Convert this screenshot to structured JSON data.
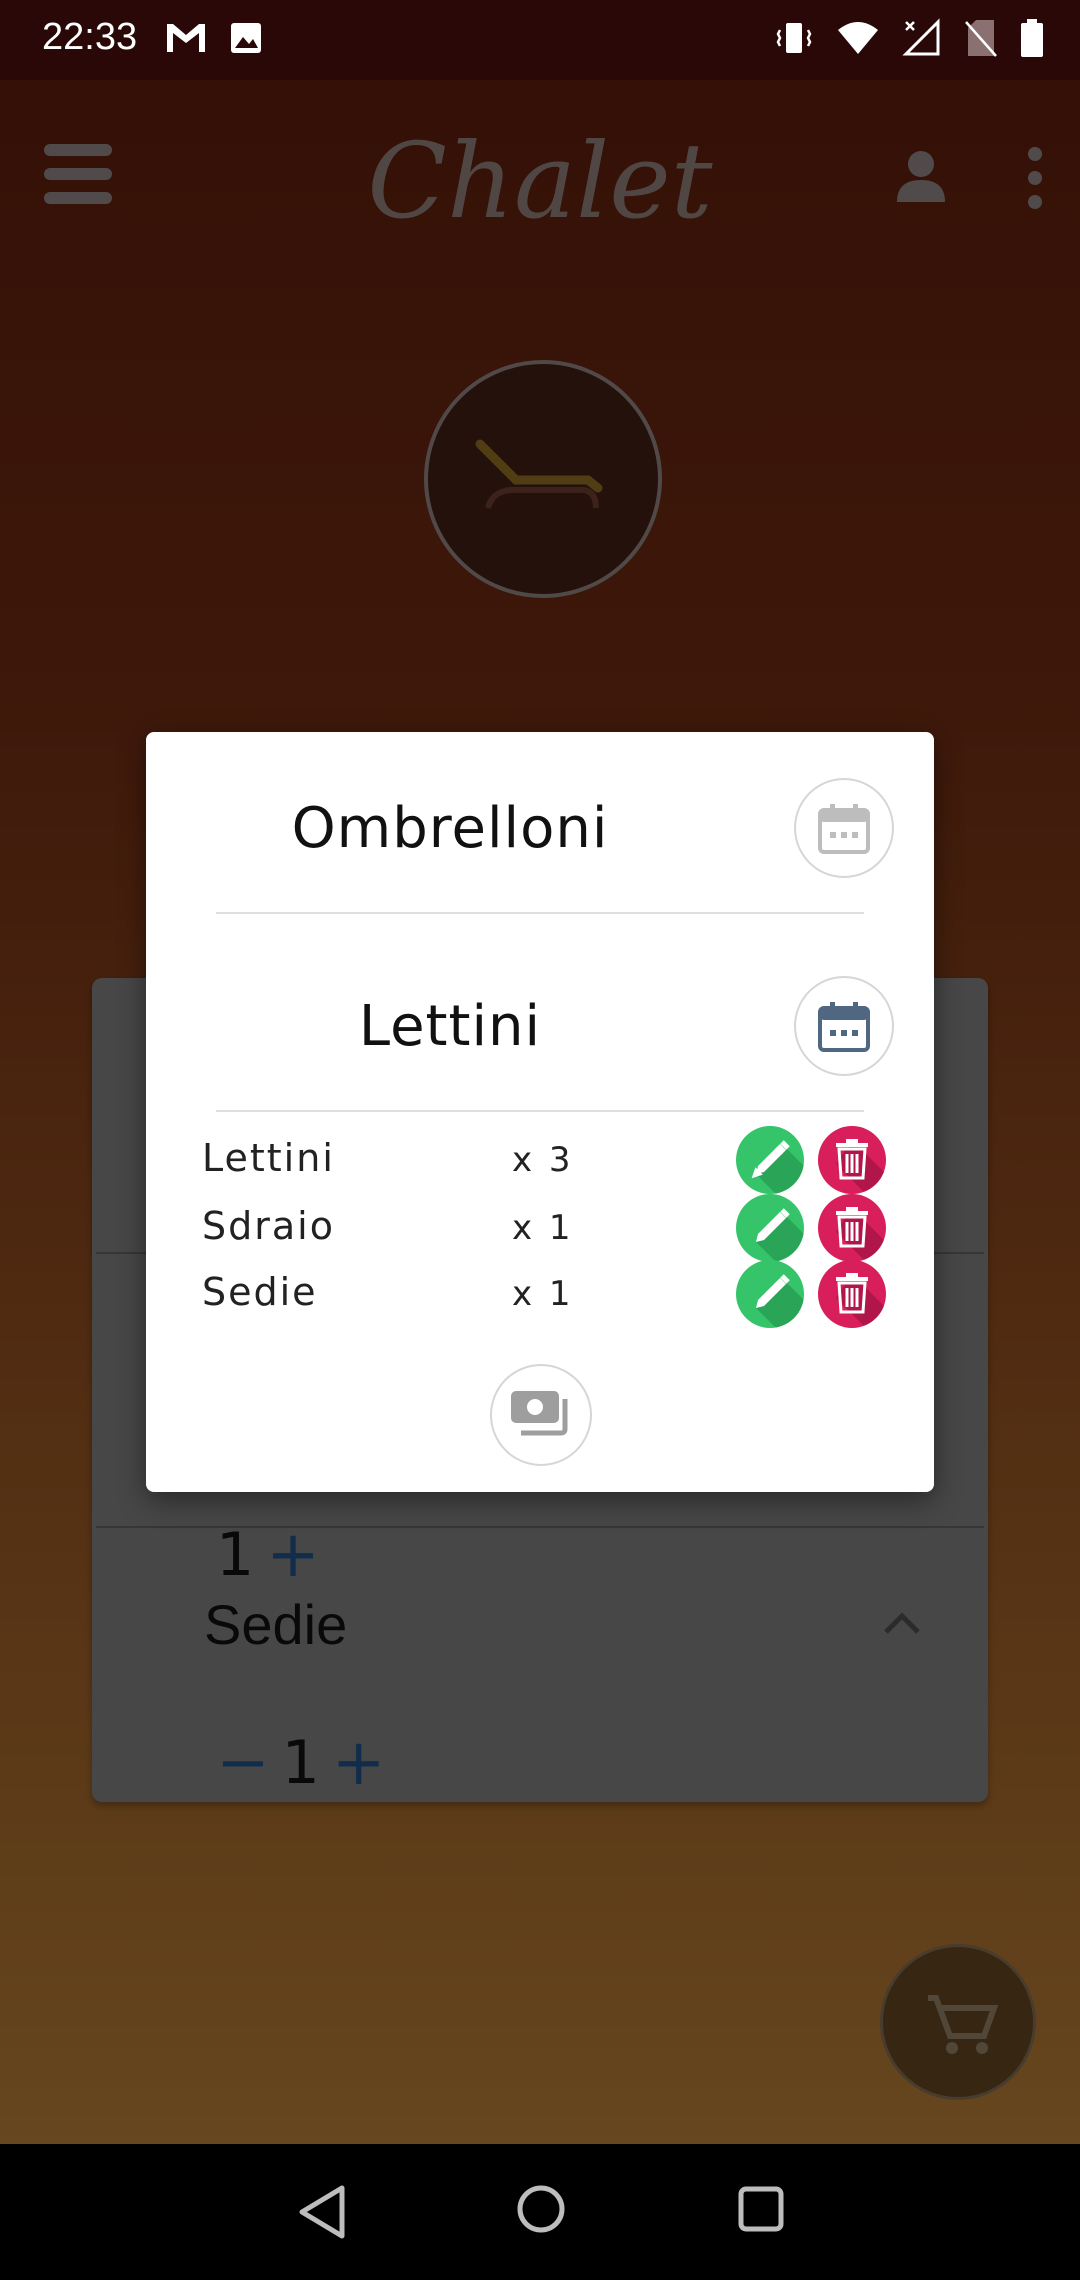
{
  "status_bar": {
    "time": "22:33",
    "left_icons": [
      "gmail-icon",
      "image-icon"
    ],
    "right_icons": [
      "vibrate-icon",
      "wifi-icon",
      "signal-icon",
      "no-sim-icon",
      "battery-icon"
    ]
  },
  "app": {
    "title": "Chalet",
    "category_icon": "sunbed-icon"
  },
  "background_card": {
    "sections": [
      {
        "title": "Sedie",
        "quantity": "1"
      }
    ],
    "partial_quantity": "1"
  },
  "dialog": {
    "sections": [
      {
        "title": "Ombrelloni",
        "icon": "calendar-icon"
      },
      {
        "title": "Lettini",
        "icon": "calendar-icon"
      }
    ],
    "items": [
      {
        "name": "Lettini",
        "qty": "x 3"
      },
      {
        "name": "Sdraio",
        "qty": "x 1"
      },
      {
        "name": "Sedie",
        "qty": "x 1"
      }
    ],
    "pay_icon": "payment-icon"
  },
  "fab": {
    "icon": "cart-icon"
  },
  "colors": {
    "edit": "#35c46a",
    "delete": "#d81e5b",
    "stepper": "#1f4f82"
  }
}
